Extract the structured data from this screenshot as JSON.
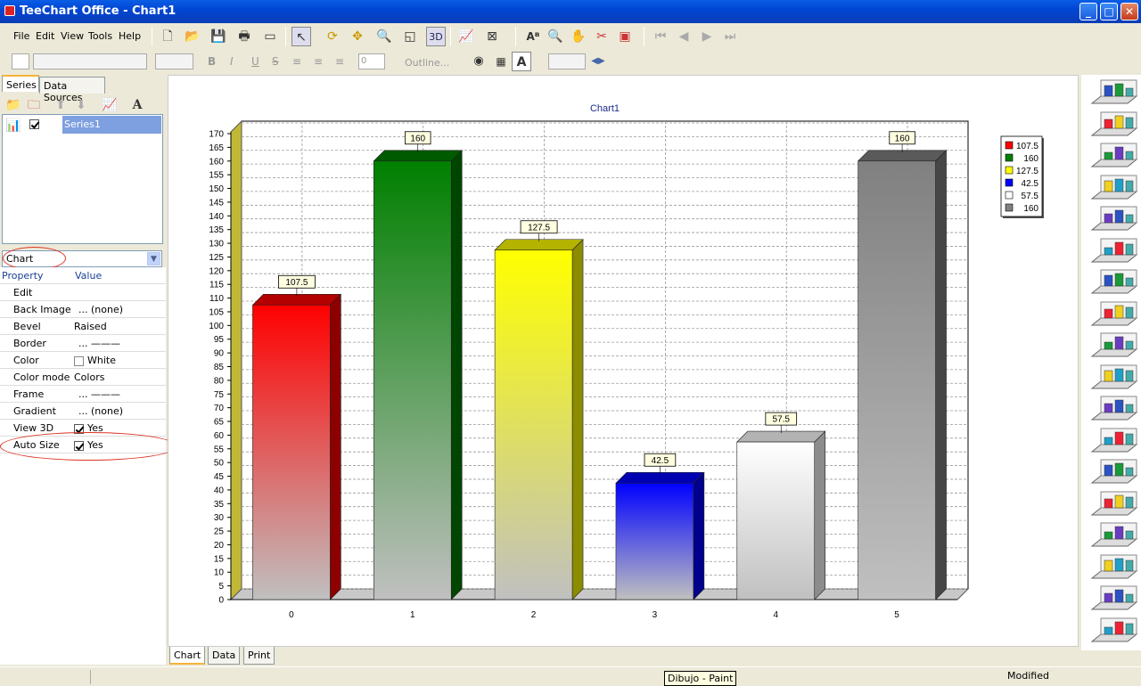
{
  "window": {
    "title": "TeeChart Office - Chart1",
    "minimize": "_",
    "maximize": "□",
    "close": "✕"
  },
  "menu": [
    "File",
    "Edit",
    "View",
    "Tools",
    "Help"
  ],
  "toolbar": {
    "3d_label": "3D",
    "outline_placeholder": "Outline...",
    "spin_value": "0"
  },
  "left_tabs": {
    "series": "Series",
    "data_sources": "Data Sources"
  },
  "series_list": [
    {
      "name": "Series1",
      "checked": true
    }
  ],
  "object_selector": {
    "value": "Chart"
  },
  "property_header": {
    "property": "Property",
    "value": "Value"
  },
  "properties": [
    {
      "name": "Edit",
      "value": ""
    },
    {
      "name": "Back Image",
      "value": "... (none)"
    },
    {
      "name": "Bevel",
      "value": "Raised"
    },
    {
      "name": "Border",
      "value": "... ———"
    },
    {
      "name": "Color",
      "value": "White"
    },
    {
      "name": "Color mode",
      "value": "Colors"
    },
    {
      "name": "Frame",
      "value": "... ———"
    },
    {
      "name": "Gradient",
      "value": "... (none)"
    },
    {
      "name": "View 3D",
      "value": "Yes"
    },
    {
      "name": "Auto Size",
      "value": "Yes"
    }
  ],
  "bottom_tabs": [
    "Chart",
    "Data",
    "Print"
  ],
  "status": {
    "text": "Modified",
    "tooltip": "Dibujo - Paint"
  },
  "gallery_icons": [
    "area-3d-icon",
    "bar-3d-icon",
    "horiz-bar-icon",
    "pie-icon",
    "shapes-icon",
    "line-icon",
    "donut-icon",
    "cube-bar-icon",
    "spike-icon",
    "fastline-icon",
    "surface-icon",
    "stair-icon",
    "point-icon",
    "pyramid-icon",
    "map-icon",
    "tree-icon",
    "scatter-icon",
    "ramp-icon"
  ],
  "chart_data": {
    "type": "bar",
    "title": "Chart1",
    "categories": [
      "0",
      "1",
      "2",
      "3",
      "4",
      "5"
    ],
    "values": [
      107.5,
      160,
      127.5,
      42.5,
      57.5,
      160
    ],
    "colors": [
      "#FF0000",
      "#008000",
      "#FFFF00",
      "#0000FF",
      "#FFFFFF",
      "#808080"
    ],
    "ylim": [
      0,
      170
    ],
    "ytick_step": 5,
    "grid": true,
    "view3d": true,
    "legend_position": "top-right",
    "legend": [
      "107.5",
      "160",
      "127.5",
      "42.5",
      "57.5",
      "160"
    ]
  }
}
